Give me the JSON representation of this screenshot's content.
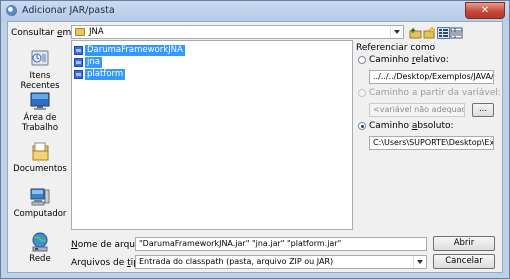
{
  "window": {
    "title": "Adicionar JAR/pasta",
    "close_glyph": "✕"
  },
  "lookin": {
    "label_pre": "Consultar ",
    "label_key": "e",
    "label_post": "m:",
    "value": "JNA"
  },
  "places": [
    {
      "label": "Itens Recentes",
      "icon": "recent-items-icon"
    },
    {
      "label": "Área de Trabalho",
      "icon": "desktop-icon"
    },
    {
      "label": "Documentos",
      "icon": "documents-icon"
    },
    {
      "label": "Computador",
      "icon": "computer-icon"
    },
    {
      "label": "Rede",
      "icon": "network-icon"
    }
  ],
  "files": [
    {
      "name": "DarumaFrameworkJNA"
    },
    {
      "name": "jna"
    },
    {
      "name": "platform"
    }
  ],
  "reference": {
    "title": "Referenciar como",
    "relative": {
      "label_pre": "Caminho ",
      "label_key": "r",
      "label_post": "elativo:",
      "value": "../../../Desktop/Exemplos/JAVA/Darum"
    },
    "variable": {
      "label": "Caminho a partir da variável:",
      "value": "<variável não adequad",
      "button": "..."
    },
    "absolute": {
      "label_pre": "Caminho ",
      "label_key": "a",
      "label_post": "bsoluto:",
      "value": "C:\\Users\\SUPORTE\\Desktop\\Exemplos"
    }
  },
  "filename": {
    "label_pre": "",
    "label_key": "N",
    "label_post": "ome de arquivo:",
    "value": "\"DarumaFrameworkJNA.jar\" \"jna.jar\" \"platform.jar\""
  },
  "filetype": {
    "label_pre": "Arquivos de ",
    "label_key": "t",
    "label_post": "ipo:",
    "value": "Entrada do classpath (pasta, arquivo ZIP ou JAR)"
  },
  "buttons": {
    "open": "Abrir",
    "cancel": "Cancelar"
  },
  "colors": {
    "selection": "#3399ff",
    "titlebar": "#bcd1ea",
    "close": "#c64b3a"
  }
}
